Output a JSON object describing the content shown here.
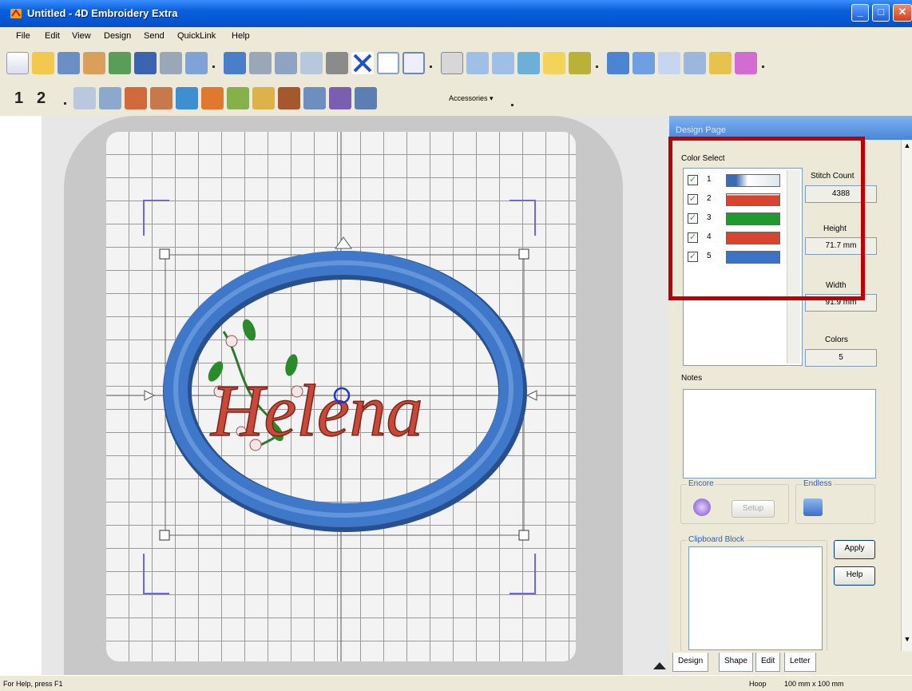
{
  "window": {
    "title": "Untitled - 4D Embroidery Extra",
    "minimize_glyph": "_",
    "maximize_glyph": "□",
    "close_glyph": "✕"
  },
  "menu": {
    "items": [
      "File",
      "Edit",
      "View",
      "Design",
      "Send",
      "QuickLink",
      "Help"
    ]
  },
  "toolbar2": {
    "num1": "1",
    "num2": "2",
    "accessories_label": "Accessories ▾"
  },
  "design_text": "Helena",
  "panel": {
    "header": "Design Page",
    "color_select_label": "Color Select",
    "colors": [
      {
        "num": "1",
        "color": "#dfe6ee",
        "checked": true
      },
      {
        "num": "2",
        "color": "#d8442e",
        "checked": true
      },
      {
        "num": "3",
        "color": "#1e9a2e",
        "checked": true
      },
      {
        "num": "4",
        "color": "#d8442e",
        "checked": true
      },
      {
        "num": "5",
        "color": "#3b73c9",
        "checked": true
      }
    ],
    "stitch_count_label": "Stitch Count",
    "stitch_count_value": "4388",
    "height_label": "Height",
    "height_value": "71.7 mm",
    "width_label": "Width",
    "width_value": "91.9 mm",
    "colors_label": "Colors",
    "colors_value": "5",
    "notes_label": "Notes",
    "encore_label": "Encore",
    "setup_label": "Setup",
    "endless_label": "Endless",
    "clipboard_label": "Clipboard Block",
    "apply_label": "Apply",
    "help_label": "Help"
  },
  "tabs": [
    "Design",
    "Shape",
    "Edit",
    "Letter"
  ],
  "status": {
    "left": "For Help, press F1",
    "hoop_label": "Hoop",
    "hoop_value": "100 mm x 100 mm"
  },
  "accent_colors": {
    "title_blue": "#0554d2",
    "ellipse_blue": "#3f78c8",
    "lettering_red": "#c8493a",
    "highlight_red": "#c00000"
  }
}
